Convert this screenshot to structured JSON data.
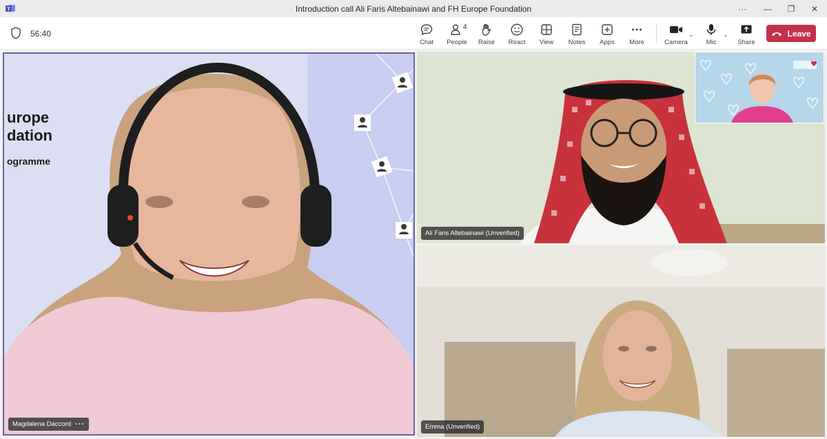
{
  "window": {
    "title": "Introduction call Ali Faris Altebainawi and FH Europe Foundation",
    "controls": [
      "···",
      "—",
      "❐",
      "✕"
    ]
  },
  "toolbar": {
    "timer": "56:40",
    "people_count": "4",
    "buttons": {
      "chat": "Chat",
      "people": "People",
      "raise": "Raise",
      "react": "React",
      "view": "View",
      "notes": "Notes",
      "apps": "Apps",
      "more": "More",
      "camera": "Camera",
      "mic": "Mic",
      "share": "Share"
    },
    "leave_label": "Leave",
    "leave_color": "#c4314b"
  },
  "participants": {
    "main": {
      "name": "Magdalena Daccord",
      "more": "···",
      "background_lines": [
        "urope",
        "dation",
        "ogramme"
      ]
    },
    "ali": {
      "name": "Ali Faris Altebainawi (Unverified)"
    },
    "emma": {
      "name": "Emma (Unverified)"
    },
    "self": {
      "name": ""
    }
  },
  "colors": {
    "accent": "#6264a7",
    "leave": "#c4314b"
  }
}
